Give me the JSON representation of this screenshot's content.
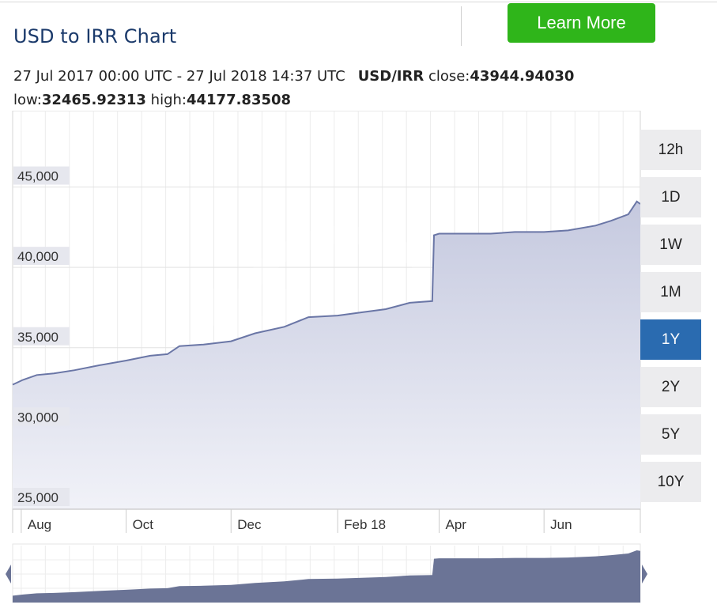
{
  "header": {
    "title": "USD to IRR Chart",
    "learn_more_label": "Learn More"
  },
  "info": {
    "date_range": "27 Jul 2017 00:00 UTC - 27 Jul 2018 14:37 UTC",
    "pair": "USD/IRR",
    "close_label": "close:",
    "close_value": "43944.94030",
    "low_label": "low:",
    "low_value": "32465.92313",
    "high_label": "high:",
    "high_value": "44177.83508"
  },
  "range_buttons": [
    {
      "label": "12h",
      "active": false
    },
    {
      "label": "1D",
      "active": false
    },
    {
      "label": "1W",
      "active": false
    },
    {
      "label": "1M",
      "active": false
    },
    {
      "label": "1Y",
      "active": true
    },
    {
      "label": "2Y",
      "active": false
    },
    {
      "label": "5Y",
      "active": false
    },
    {
      "label": "10Y",
      "active": false
    }
  ],
  "colors": {
    "line": "#6a76a6",
    "area_top": "#c5c9df",
    "area_bottom": "#f1f2f8",
    "navigator_fill": "#6b7496",
    "active_button": "#2a6bb0",
    "learn_more": "#2fb51a"
  },
  "chart_data": {
    "type": "area",
    "title": "USD to IRR Chart",
    "x_tick_labels": [
      "Aug",
      "Oct",
      "Dec",
      "Feb 18",
      "Apr",
      "Jun"
    ],
    "x_ticks": [
      "2017-08-01",
      "2017-10-01",
      "2017-12-01",
      "2018-02-01",
      "2018-04-01",
      "2018-06-01"
    ],
    "y_tick_values": [
      25000,
      30000,
      35000,
      40000,
      45000
    ],
    "y_tick_labels": [
      "25,000",
      "30,000",
      "35,000",
      "40,000",
      "45,000"
    ],
    "xlim": [
      "2017-07-27",
      "2018-07-27"
    ],
    "ylim": [
      24950,
      49750
    ],
    "grid": true,
    "series": [
      {
        "x": [
          "2017-07-27",
          "2017-08-02",
          "2017-08-10",
          "2017-08-20",
          "2017-09-01",
          "2017-09-15",
          "2017-10-01",
          "2017-10-15",
          "2017-10-25",
          "2017-11-01",
          "2017-11-15",
          "2017-12-01",
          "2017-12-15",
          "2018-01-01",
          "2018-01-15",
          "2018-02-01",
          "2018-02-15",
          "2018-03-01",
          "2018-03-15",
          "2018-03-28",
          "2018-03-29",
          "2018-04-01",
          "2018-04-15",
          "2018-05-01",
          "2018-05-15",
          "2018-06-01",
          "2018-06-15",
          "2018-07-01",
          "2018-07-10",
          "2018-07-20",
          "2018-07-25",
          "2018-07-27"
        ],
        "values": [
          32700,
          33000,
          33300,
          33400,
          33600,
          33900,
          34200,
          34500,
          34600,
          35100,
          35200,
          35400,
          35900,
          36300,
          36900,
          37000,
          37200,
          37400,
          37800,
          37900,
          42000,
          42100,
          42100,
          42100,
          42200,
          42200,
          42300,
          42600,
          42900,
          43300,
          44100,
          43945
        ]
      }
    ],
    "low": 32465.92313,
    "high": 44177.83508,
    "close": 43944.9403
  }
}
